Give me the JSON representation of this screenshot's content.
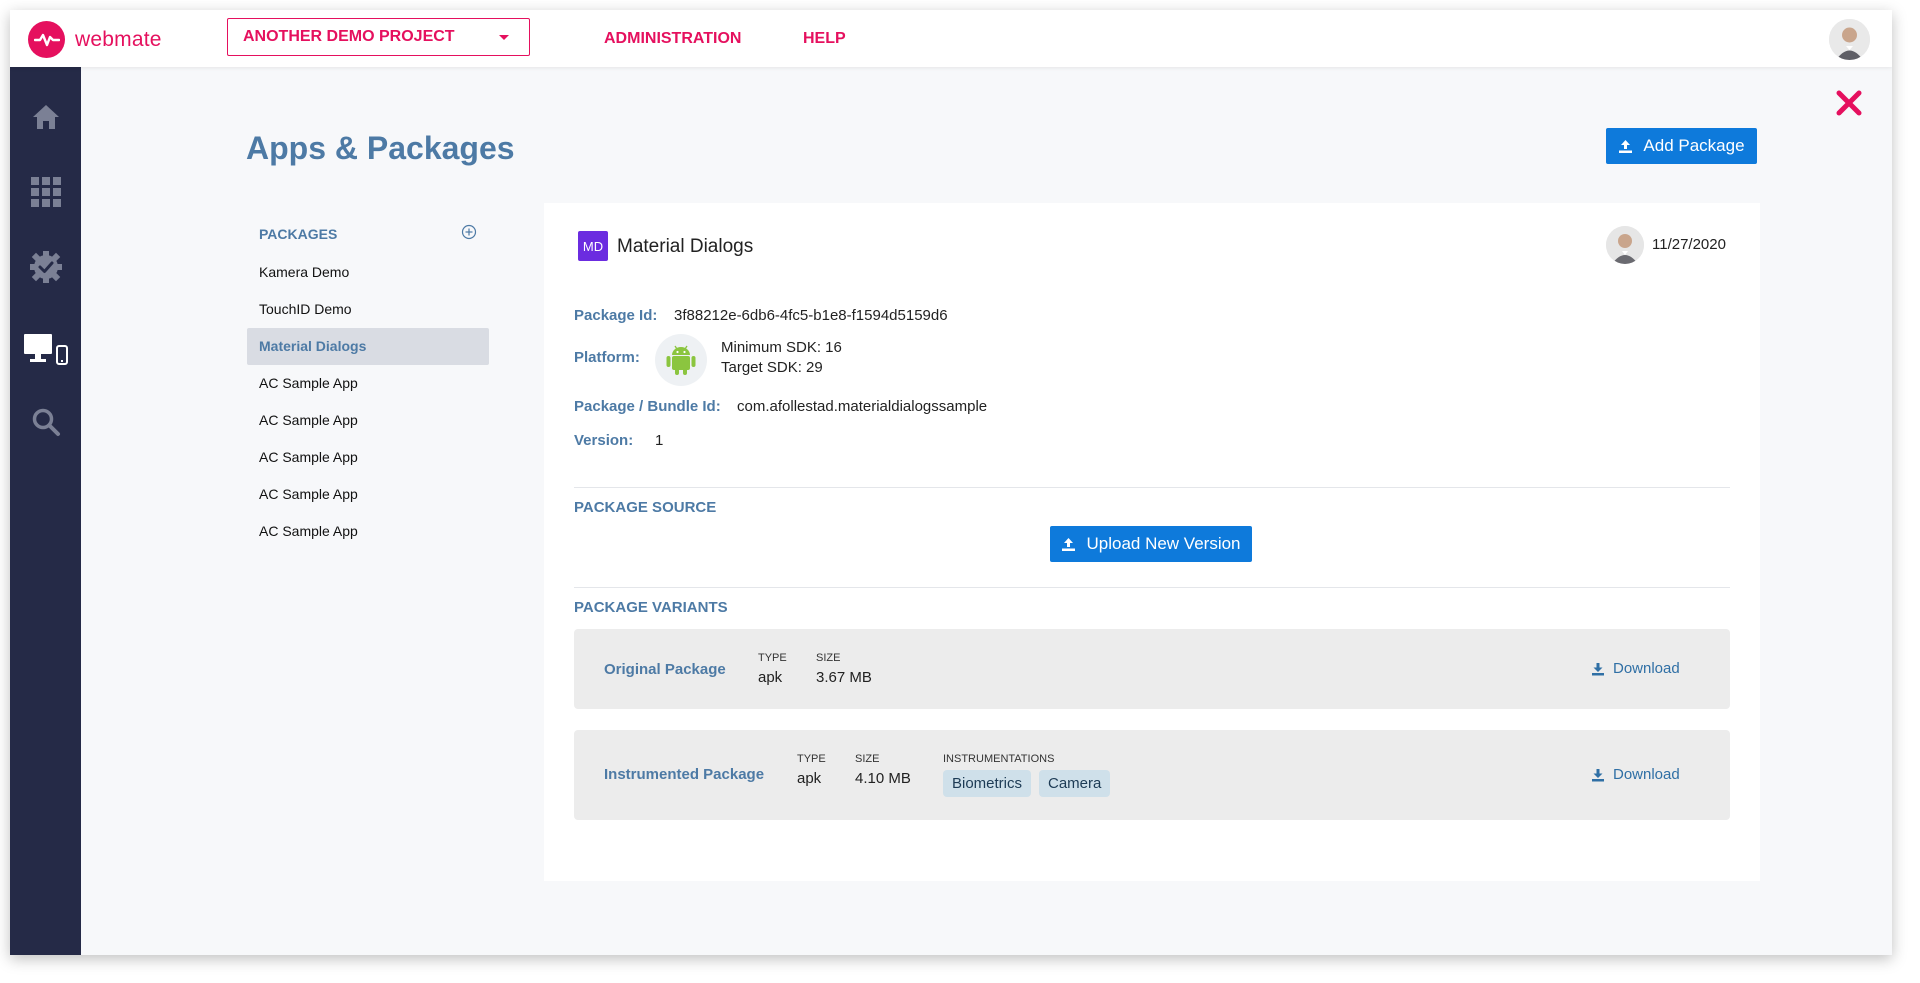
{
  "brand": {
    "name": "webmate"
  },
  "header": {
    "project": "ANOTHER DEMO PROJECT",
    "nav": [
      "ADMINISTRATION",
      "HELP"
    ]
  },
  "sidebar": {
    "items": [
      {
        "icon": "home-icon"
      },
      {
        "icon": "apps-grid-icon"
      },
      {
        "icon": "settings-check-icon"
      },
      {
        "icon": "devices-icon"
      },
      {
        "icon": "search-icon"
      }
    ]
  },
  "page": {
    "title": "Apps & Packages",
    "add_package_label": "Add Package"
  },
  "packages": {
    "header": "PACKAGES",
    "items": [
      "Kamera Demo",
      "TouchID Demo",
      "Material Dialogs",
      "AC Sample App",
      "AC Sample App",
      "AC Sample App",
      "AC Sample App",
      "AC Sample App"
    ],
    "selected": "Material Dialogs"
  },
  "detail": {
    "badge": "MD",
    "name": "Material Dialogs",
    "date": "11/27/2020",
    "package_id_label": "Package Id:",
    "package_id": "3f88212e-6db6-4fc5-b1e8-f1594d5159d6",
    "platform_label": "Platform:",
    "min_sdk": "Minimum SDK: 16",
    "target_sdk": "Target SDK: 29",
    "bundle_label": "Package / Bundle Id:",
    "bundle_id": "com.afollestad.materialdialogssample",
    "version_label": "Version:",
    "version": "1",
    "source_title": "PACKAGE SOURCE",
    "upload_label": "Upload New Version",
    "variants_title": "PACKAGE VARIANTS",
    "variants": [
      {
        "name": "Original Package",
        "type_label": "TYPE",
        "type": "apk",
        "size_label": "SIZE",
        "size": "3.67 MB",
        "download": "Download"
      },
      {
        "name": "Instrumented Package",
        "type_label": "TYPE",
        "type": "apk",
        "size_label": "SIZE",
        "size": "4.10 MB",
        "instr_label": "INSTRUMENTATIONS",
        "tags": [
          "Biometrics",
          "Camera"
        ],
        "download": "Download"
      }
    ]
  },
  "colors": {
    "brand": "#e5105e",
    "accent_blue": "#0e7adb",
    "label_blue": "#4d7aa5",
    "sidebar": "#252a47"
  }
}
